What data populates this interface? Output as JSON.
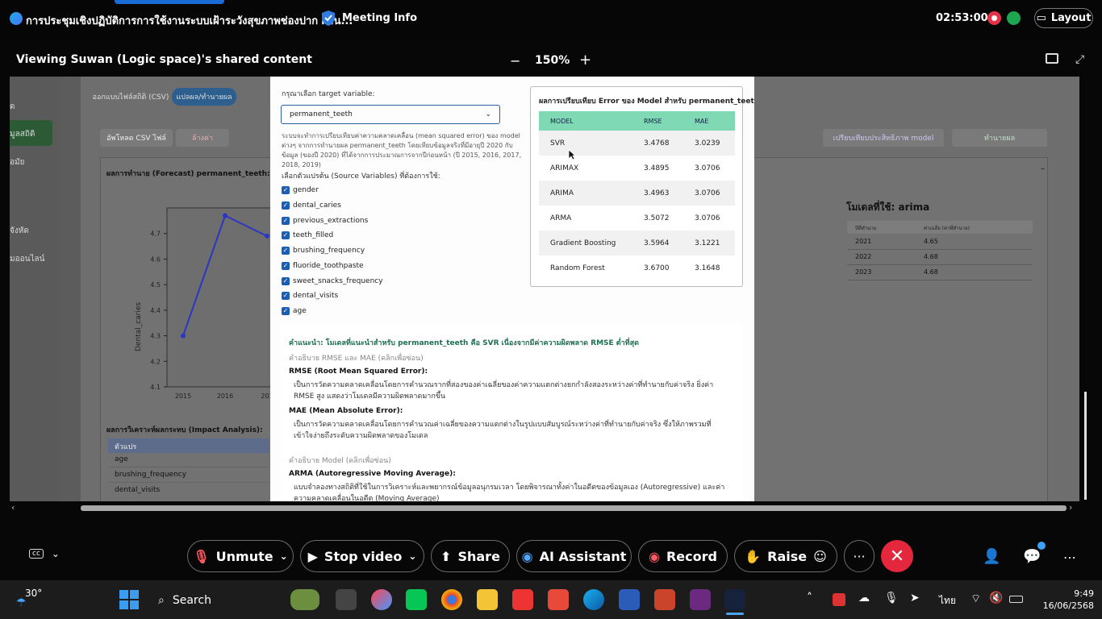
{
  "topbar": {
    "meeting_title": "การประชุมเชิงปฏิบัติการการใช้งานระบบเฝ้าระวังสุขภาพช่องปาก ผ่าน...",
    "meeting_info": "Meeting Info",
    "clock": "02:53:00",
    "layout_label": "Layout"
  },
  "viewbar": {
    "viewing": "Viewing Suwan (Logic space)'s shared content",
    "zoom_out": "−",
    "zoom": "150%",
    "zoom_in": "+"
  },
  "background": {
    "side_items": [
      "ด",
      "มูลสถิติ",
      "อมัย",
      "จังหัด",
      "มออนไลน์"
    ],
    "tab_csv": "ออกแบบไฟล์สถิติ (CSV)",
    "tab_predict": "แปลผล/ทำนายผล",
    "upload_btn": "อัพโหลด CSV ไฟล์",
    "clear_btn": "ล้างค่า",
    "compare_btn": "เปรียบเทียบประสิทธิภาพ model",
    "predict_btn": "ทำนายผล",
    "forecast_title": "ผลการทำนาย (Forecast) permanent_teeth:",
    "y_axis_label": "Dental_caries",
    "y_ticks": [
      "4.7",
      "4.6",
      "4.5",
      "4.4",
      "4.3",
      "4.2",
      "4.1"
    ],
    "x_ticks": [
      "2015",
      "2016",
      "201"
    ],
    "impact_title": "ผลการวิเคราะห์ผลกระทบ (Impact Analysis):",
    "impact_header": "ตัวแปร",
    "impact_rows": [
      "age",
      "brushing_frequency",
      "dental_visits"
    ],
    "model_used": "โมเดลที่ใช้: arima",
    "pred_head_year": "ปีที่ทำนาย",
    "pred_head_value": "ค่าเฉลี่ย (ค่าที่ทำนาย)",
    "pred_rows": [
      {
        "year": "2021",
        "value": "4.65"
      },
      {
        "year": "2022",
        "value": "4.68"
      },
      {
        "year": "2023",
        "value": "4.68"
      }
    ]
  },
  "modal": {
    "target_label": "กรุณาเลือก target variable:",
    "target_value": "permanent_teeth",
    "description": "ระบบจะทำการเปรียบเทียบค่าความคลาดเคลื่อน (mean squared error) ของ model ต่างๆ จากการทำนายผล permanent_teeth โดยเทียบข้อมูลจริงที่มีอายุปี 2020 กับข้อมูล (ของปี 2020) ที่ได้จากการประมาณการจากปีก่อนหน้า (ปี 2015, 2016, 2017, 2018, 2019)",
    "vars_title": "เลือกตัวแปรต้น (Source Variables) ที่ต้องการใช้:",
    "variables": [
      "gender",
      "dental_caries",
      "previous_extractions",
      "teeth_filled",
      "brushing_frequency",
      "fluoride_toothpaste",
      "sweet_snacks_frequency",
      "dental_visits",
      "age"
    ],
    "table_title": "ผลการเปรียบเทียบ Error ของ Model สำหรับ permanent_teeth",
    "table_headers": [
      "MODEL",
      "RMSE",
      "MAE"
    ],
    "table_rows": [
      {
        "model": "SVR",
        "rmse": "3.4768",
        "mae": "3.0239"
      },
      {
        "model": "ARIMAX",
        "rmse": "3.4895",
        "mae": "3.0706"
      },
      {
        "model": "ARIMA",
        "rmse": "3.4963",
        "mae": "3.0706"
      },
      {
        "model": "ARMA",
        "rmse": "3.5072",
        "mae": "3.0706"
      },
      {
        "model": "Gradient Boosting",
        "rmse": "3.5964",
        "mae": "3.1221"
      },
      {
        "model": "Random Forest",
        "rmse": "3.6700",
        "mae": "3.1648"
      }
    ],
    "recommendation": "คำแนะนำ: โมเดลที่แนะนำสำหรับ permanent_teeth คือ SVR เนื่องจากมีค่าความผิดพลาด RMSE ต่ำที่สุด",
    "explain_link": "คำอธิบาย RMSE และ MAE (คลิกเพื่อซ่อน)",
    "rmse_title": "RMSE (Root Mean Squared Error):",
    "rmse_text": "เป็นการวัดความคลาดเคลื่อนโดยการคำนวณรากที่สองของค่าเฉลี่ยของค่าความแตกต่างยกกำลังสองระหว่างค่าที่ทำนายกับค่าจริง ยิ่งค่า RMSE สูง แสดงว่าโมเดลมีความผิดพลาดมากขึ้น",
    "mae_title": "MAE (Mean Absolute Error):",
    "mae_text": "เป็นการวัดความคลาดเคลื่อนโดยการคำนวณค่าเฉลี่ยของความแตกต่างในรูปแบบสัมบูรณ์ระหว่างค่าที่ทำนายกับค่าจริง ซึ่งให้ภาพรวมที่เข้าใจง่ายถึงระดับความผิดพลาดของโมเดล",
    "model_link": "คำอธิบาย Model (คลิกเพื่อซ่อน)",
    "arma_title": "ARMA (Autoregressive Moving Average):",
    "arma_text": "แบบจำลองทางสถิติที่ใช้ในการวิเคราะห์และพยากรณ์ข้อมูลอนุกรมเวลา โดยพิจารณาทั้งค่าในอดีตของข้อมูลเอง (Autoregressive) และค่าความคลาดเคลื่อนในอดีต (Moving Average)"
  },
  "controls": {
    "unmute": "Unmute",
    "stop_video": "Stop video",
    "share": "Share",
    "ai_assistant": "AI Assistant",
    "record": "Record",
    "raise": "Raise"
  },
  "taskbar": {
    "weather": "30°",
    "search": "Search",
    "lang": "ไทย",
    "time": "9:49",
    "date": "16/06/2568"
  },
  "chart_data": {
    "type": "line",
    "x": [
      "2015",
      "2016",
      "2017"
    ],
    "values": [
      4.3,
      4.77,
      4.69
    ],
    "ylabel": "Dental_caries",
    "ylim": [
      4.1,
      4.8
    ]
  }
}
